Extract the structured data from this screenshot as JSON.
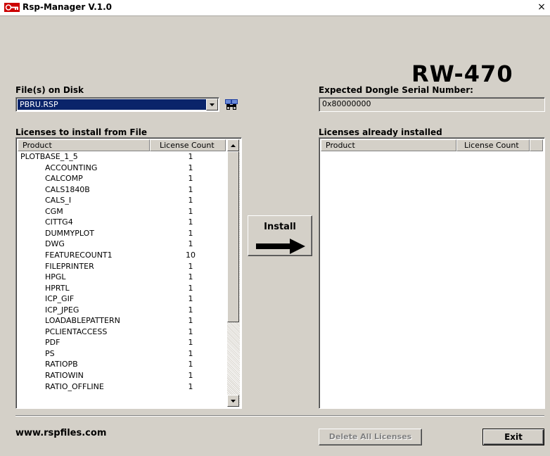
{
  "window": {
    "title": "Rsp-Manager V.1.0",
    "close_glyph": "×"
  },
  "header": {
    "model": "RW-470"
  },
  "files_on_disk": {
    "label": "File(s) on Disk",
    "selected": "PBRU.RSP",
    "browse_icon": "binoculars-icon"
  },
  "serial": {
    "label": "Expected Dongle Serial Number:",
    "value": "0x80000000"
  },
  "licenses_from_file": {
    "label": "Licenses to install from File",
    "columns": [
      "Product",
      "License Count"
    ],
    "rows": [
      {
        "product": "PLOTBASE_1_5",
        "count": "1",
        "indent": false
      },
      {
        "product": "ACCOUNTING",
        "count": "1",
        "indent": true
      },
      {
        "product": "CALCOMP",
        "count": "1",
        "indent": true
      },
      {
        "product": "CALS1840B",
        "count": "1",
        "indent": true
      },
      {
        "product": "CALS_I",
        "count": "1",
        "indent": true
      },
      {
        "product": "CGM",
        "count": "1",
        "indent": true
      },
      {
        "product": "CITTG4",
        "count": "1",
        "indent": true
      },
      {
        "product": "DUMMYPLOT",
        "count": "1",
        "indent": true
      },
      {
        "product": "DWG",
        "count": "1",
        "indent": true
      },
      {
        "product": "FEATURECOUNT1",
        "count": "10",
        "indent": true
      },
      {
        "product": "FILEPRINTER",
        "count": "1",
        "indent": true
      },
      {
        "product": "HPGL",
        "count": "1",
        "indent": true
      },
      {
        "product": "HPRTL",
        "count": "1",
        "indent": true
      },
      {
        "product": "ICP_GIF",
        "count": "1",
        "indent": true
      },
      {
        "product": "ICP_JPEG",
        "count": "1",
        "indent": true
      },
      {
        "product": "LOADABLEPATTERN",
        "count": "1",
        "indent": true
      },
      {
        "product": "PCLIENTACCESS",
        "count": "1",
        "indent": true
      },
      {
        "product": "PDF",
        "count": "1",
        "indent": true
      },
      {
        "product": "PS",
        "count": "1",
        "indent": true
      },
      {
        "product": "RATIOPB",
        "count": "1",
        "indent": true
      },
      {
        "product": "RATIOWIN",
        "count": "1",
        "indent": true
      },
      {
        "product": "RATIO_OFFLINE",
        "count": "1",
        "indent": true
      }
    ]
  },
  "licenses_installed": {
    "label": "Licenses already installed",
    "columns": [
      "Product",
      "License Count"
    ],
    "rows": []
  },
  "install_button": {
    "label": "Install"
  },
  "footer": {
    "website": "www.rspfiles.com",
    "delete_all_label": "Delete All Licenses",
    "exit_label": "Exit"
  },
  "colors": {
    "face": "#d4d0c8",
    "selection": "#0a246a",
    "title_icon": "#cc0000"
  }
}
